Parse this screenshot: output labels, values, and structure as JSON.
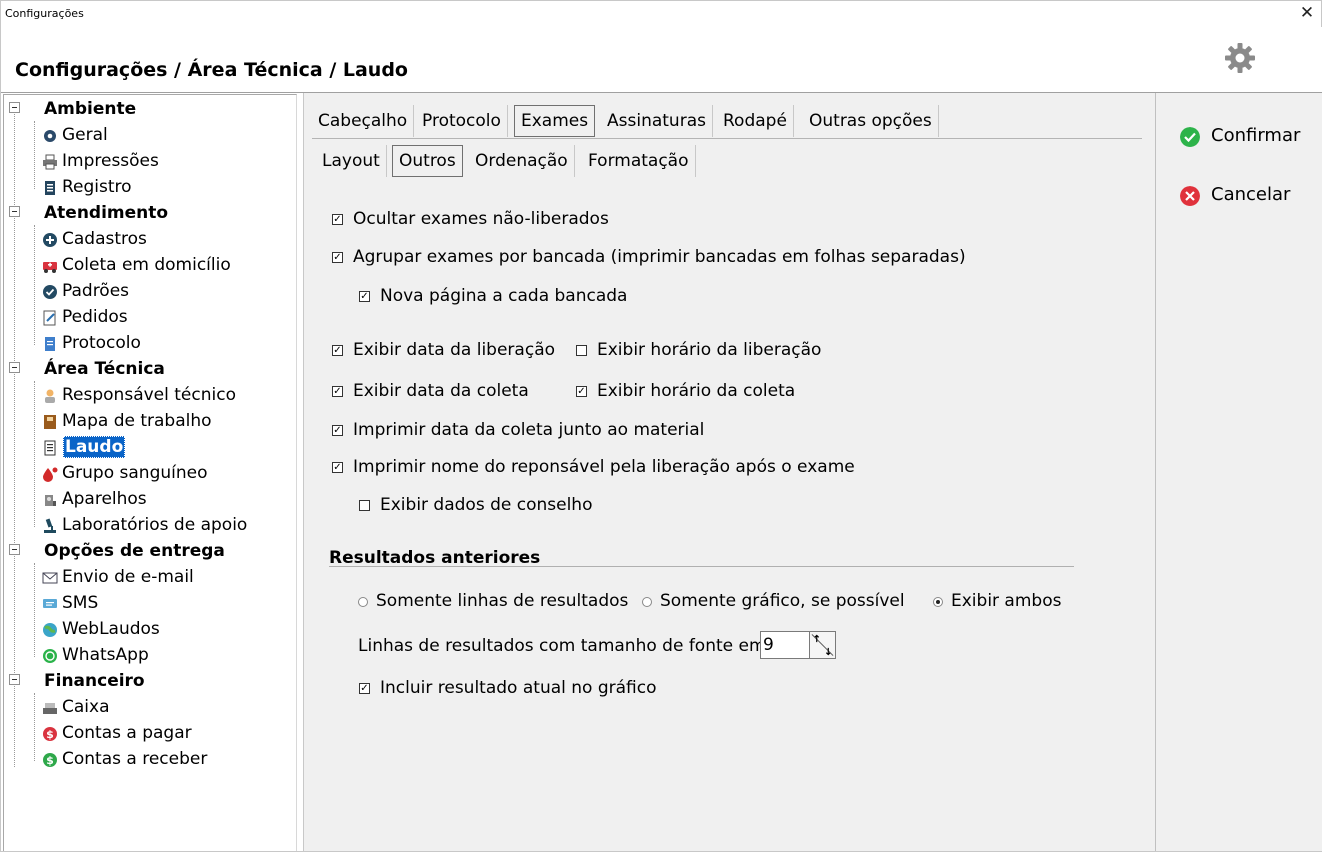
{
  "window": {
    "title": "Configurações",
    "close_glyph": "✕"
  },
  "header": {
    "breadcrumb": "Configurações / Área Técnica / Laudo",
    "settings_icon": "gear-icon"
  },
  "tree": {
    "groups": [
      {
        "label": "Ambiente",
        "items": [
          {
            "label": "Geral",
            "icon": "gear-icon"
          },
          {
            "label": "Impressões",
            "icon": "printer-icon"
          },
          {
            "label": "Registro",
            "icon": "register-icon"
          }
        ]
      },
      {
        "label": "Atendimento",
        "items": [
          {
            "label": "Cadastros",
            "icon": "plus-circle-icon"
          },
          {
            "label": "Coleta em domicílio",
            "icon": "ambulance-icon"
          },
          {
            "label": "Padrões",
            "icon": "check-circle-icon"
          },
          {
            "label": "Pedidos",
            "icon": "edit-document-icon"
          },
          {
            "label": "Protocolo",
            "icon": "document-icon"
          }
        ]
      },
      {
        "label": "Área Técnica",
        "items": [
          {
            "label": "Responsável técnico",
            "icon": "person-icon"
          },
          {
            "label": "Mapa de trabalho",
            "icon": "book-icon"
          },
          {
            "label": "Laudo",
            "icon": "report-icon",
            "selected": true
          },
          {
            "label": "Grupo sanguíneo",
            "icon": "blood-drop-icon"
          },
          {
            "label": "Aparelhos",
            "icon": "device-icon"
          },
          {
            "label": "Laboratórios de apoio",
            "icon": "microscope-icon"
          }
        ]
      },
      {
        "label": "Opções de entrega",
        "items": [
          {
            "label": "Envio de e-mail",
            "icon": "envelope-icon"
          },
          {
            "label": "SMS",
            "icon": "sms-icon"
          },
          {
            "label": "WebLaudos",
            "icon": "globe-icon"
          },
          {
            "label": "WhatsApp",
            "icon": "whatsapp-icon"
          }
        ]
      },
      {
        "label": "Financeiro",
        "items": [
          {
            "label": "Caixa",
            "icon": "cash-register-icon"
          },
          {
            "label": "Contas a pagar",
            "icon": "dollar-red-icon"
          },
          {
            "label": "Contas a receber",
            "icon": "dollar-green-icon"
          }
        ]
      }
    ]
  },
  "tabs_main": [
    "Cabeçalho",
    "Protocolo",
    "Exames",
    "Assinaturas",
    "Rodapé",
    "Outras opções"
  ],
  "tabs_main_active": "Exames",
  "tabs_sub": [
    "Layout",
    "Outros",
    "Ordenação",
    "Formatação"
  ],
  "tabs_sub_active": "Outros",
  "options": {
    "ocultar": {
      "label": "Ocultar exames não-liberados",
      "checked": true
    },
    "agrupar": {
      "label": "Agrupar exames por bancada (imprimir bancadas em folhas separadas)",
      "checked": true
    },
    "nova_pagina": {
      "label": "Nova página a cada bancada",
      "checked": true
    },
    "data_liberacao": {
      "label": "Exibir data da liberação",
      "checked": true
    },
    "horario_liberacao": {
      "label": "Exibir horário da liberação",
      "checked": false
    },
    "data_coleta": {
      "label": "Exibir data da coleta",
      "checked": true
    },
    "horario_coleta": {
      "label": "Exibir horário da coleta",
      "checked": true
    },
    "imprimir_data_coleta": {
      "label": "Imprimir data da coleta junto ao material",
      "checked": true
    },
    "imprimir_nome": {
      "label": "Imprimir nome do reponsável pela liberação após o exame",
      "checked": true
    },
    "dados_conselho": {
      "label": "Exibir dados de conselho",
      "checked": false
    }
  },
  "resultados": {
    "title": "Resultados anteriores",
    "radios": [
      {
        "label": "Somente linhas de resultados",
        "selected": false
      },
      {
        "label": "Somente gráfico, se possível",
        "selected": false
      },
      {
        "label": "Exibir ambos",
        "selected": true
      }
    ],
    "font_label": "Linhas de resultados com tamanho de fonte em",
    "font_size": "9",
    "incluir": {
      "label": "Incluir resultado atual no gráfico",
      "checked": true
    }
  },
  "actions": {
    "confirm": {
      "label": "Confirmar",
      "color": "#2db34a"
    },
    "cancel": {
      "label": "Cancelar",
      "color": "#e0323c"
    }
  }
}
